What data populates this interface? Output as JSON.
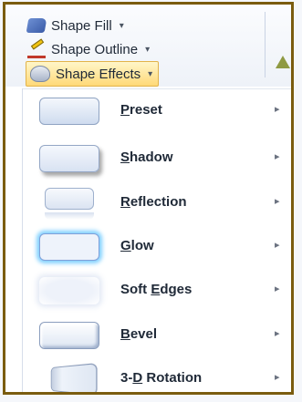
{
  "ribbon": {
    "shape_fill_label": "Shape Fill",
    "shape_outline_label": "Shape Outline",
    "shape_effects_label": "Shape Effects",
    "caret": "▾"
  },
  "menu": {
    "items": [
      {
        "before": "",
        "accel": "P",
        "after": "reset",
        "icon": "preset-effect-icon"
      },
      {
        "before": "",
        "accel": "S",
        "after": "hadow",
        "icon": "shadow-effect-icon"
      },
      {
        "before": "",
        "accel": "R",
        "after": "eflection",
        "icon": "reflection-effect-icon"
      },
      {
        "before": "",
        "accel": "G",
        "after": "low",
        "icon": "glow-effect-icon"
      },
      {
        "before": "Soft ",
        "accel": "E",
        "after": "dges",
        "icon": "soft-edges-effect-icon"
      },
      {
        "before": "",
        "accel": "B",
        "after": "evel",
        "icon": "bevel-effect-icon"
      },
      {
        "before": "3-",
        "accel": "D",
        "after": " Rotation",
        "icon": "3d-rotation-effect-icon"
      }
    ],
    "submenu_arrow": "▸"
  },
  "colors": {
    "frame_border": "#7a5c0f",
    "highlight_start": "#fff6c9",
    "highlight_end": "#ffd978"
  }
}
